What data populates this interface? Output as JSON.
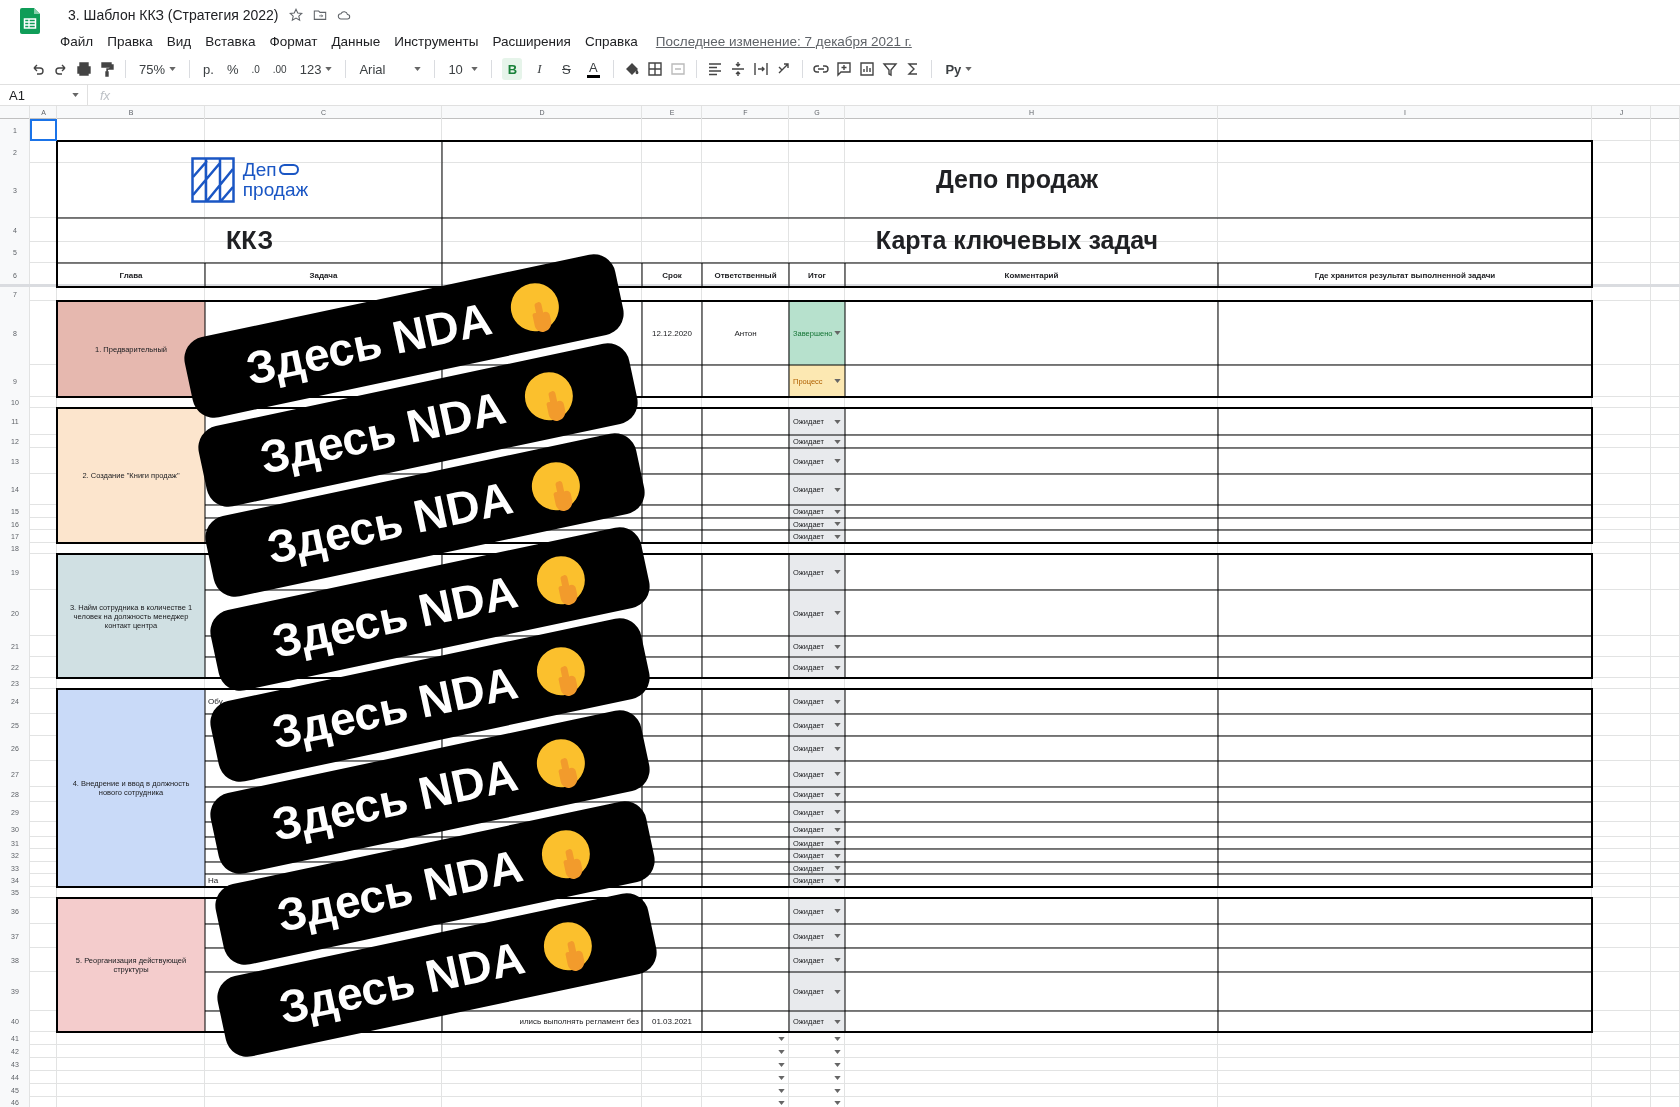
{
  "document": {
    "title": "3. Шаблон ККЗ (Стратегия 2022)"
  },
  "menu": [
    "Файл",
    "Правка",
    "Вид",
    "Вставка",
    "Формат",
    "Данные",
    "Инструменты",
    "Расширения",
    "Справка"
  ],
  "last_edit": "Последнее изменение: 7 декабря 2021 г.",
  "toolbar": {
    "zoom": "75%",
    "currency": "р.",
    "percent": "%",
    "decrease_decimals": ".0",
    "increase_decimals": ".00",
    "number_format": "123",
    "font": "Arial",
    "font_size": "10",
    "input_tools": "Ру",
    "styles": [
      {
        "label": "B",
        "selected": true
      },
      {
        "label": "I",
        "selected": false
      },
      {
        "label": "S",
        "selected": false
      },
      {
        "label": "A",
        "selected": false
      }
    ]
  },
  "formula_bar": {
    "cell": "A1",
    "fx": "fx"
  },
  "columns": [
    "A",
    "B",
    "C",
    "D",
    "E",
    "F",
    "G",
    "H",
    "I",
    "J"
  ],
  "row_numbers": [
    "1",
    "2",
    "3",
    "4",
    "5",
    "6",
    "7",
    "8",
    "9",
    "10",
    "11",
    "12",
    "13",
    "14",
    "15",
    "16",
    "17",
    "18",
    "19",
    "20",
    "21",
    "22",
    "23",
    "24",
    "25",
    "26",
    "27",
    "28",
    "29",
    "30",
    "31",
    "32",
    "33",
    "34",
    "35",
    "36",
    "37",
    "38",
    "39",
    "40",
    "41",
    "42",
    "43",
    "44",
    "45",
    "46"
  ],
  "sheet": {
    "logo": {
      "line1": "Деп",
      "line2": "продаж"
    },
    "title": "Депо продаж",
    "code": "ККЗ",
    "subtitle": "Карта ключевых задач",
    "headers": [
      "Глава",
      "Задача",
      "Срок",
      "Ответственный",
      "Итог",
      "Комментарий",
      "Где хранится результат выполненной задачи"
    ],
    "sections": [
      {
        "chapter": "1. Предварительный",
        "color": "#e6b8af",
        "tasks": [
          {
            "deadline": "12.12.2020",
            "owner": "Антон",
            "status": {
              "label": "Завершено",
              "kind": "done"
            }
          },
          {
            "status": {
              "label": "Процесс",
              "kind": "process"
            }
          }
        ]
      },
      {
        "chapter": "2. Создание \"Книги продаж\"",
        "color": "#fce5cd",
        "tasks": [
          {
            "status": {
              "label": "Ожидает",
              "kind": "waiting"
            }
          },
          {
            "status": {
              "label": "Ожидает",
              "kind": "waiting"
            }
          },
          {
            "status": {
              "label": "Ожидает",
              "kind": "waiting"
            }
          },
          {
            "status": {
              "label": "Ожидает",
              "kind": "waiting"
            }
          },
          {
            "status": {
              "label": "Ожидает",
              "kind": "waiting"
            }
          },
          {
            "status": {
              "label": "Ожидает",
              "kind": "waiting"
            }
          },
          {
            "status": {
              "label": "Ожидает",
              "kind": "waiting"
            }
          }
        ]
      },
      {
        "chapter": "3. Найм сотрудника в количестве 1 человек на должность менеджер контакт центра",
        "color": "#d0e0e3",
        "tasks": [
          {
            "status": {
              "label": "Ожидает",
              "kind": "waiting"
            }
          },
          {
            "status": {
              "label": "Ожидает",
              "kind": "waiting"
            }
          },
          {
            "status": {
              "label": "Ожидает",
              "kind": "waiting"
            }
          },
          {
            "status": {
              "label": "Ожидает",
              "kind": "waiting"
            }
          }
        ]
      },
      {
        "chapter": "4. Внедрение и ввод в должность нового сотрудника",
        "color": "#c9daf8",
        "tasks": [
          {
            "task": "Обу",
            "status": {
              "label": "Ожидает",
              "kind": "waiting"
            }
          },
          {
            "status": {
              "label": "Ожидает",
              "kind": "waiting"
            }
          },
          {
            "status": {
              "label": "Ожидает",
              "kind": "waiting"
            }
          },
          {
            "status": {
              "label": "Ожидает",
              "kind": "waiting"
            }
          },
          {
            "status": {
              "label": "Ожидает",
              "kind": "waiting"
            }
          },
          {
            "status": {
              "label": "Ожидает",
              "kind": "waiting"
            }
          },
          {
            "status": {
              "label": "Ожидает",
              "kind": "waiting"
            }
          },
          {
            "status": {
              "label": "Ожидает",
              "kind": "waiting"
            }
          },
          {
            "status": {
              "label": "Ожидает",
              "kind": "waiting"
            }
          },
          {
            "status": {
              "label": "Ожидает",
              "kind": "waiting"
            }
          },
          {
            "task": "На",
            "status": {
              "label": "Ожидает",
              "kind": "waiting"
            }
          }
        ]
      },
      {
        "chapter": "5. Реорганизация действующей структуры",
        "color": "#f4cccc",
        "tasks": [
          {
            "status": {
              "label": "Ожидает",
              "kind": "waiting"
            }
          },
          {
            "status": {
              "label": "Ожидает",
              "kind": "waiting"
            }
          },
          {
            "status": {
              "label": "Ожидает",
              "kind": "waiting"
            }
          },
          {
            "status": {
              "label": "Ожидает",
              "kind": "waiting"
            }
          },
          {
            "plan": "ились выполнять регламент без",
            "deadline": "01.03.2021",
            "status": {
              "label": "Ожидает",
              "kind": "waiting"
            }
          }
        ]
      }
    ],
    "blank_rows": [
      {
        "owner_dropdown": true,
        "status_dropdown": true
      },
      {
        "owner_dropdown": true,
        "status_dropdown": true
      },
      {
        "owner_dropdown": true,
        "status_dropdown": true
      },
      {
        "owner_dropdown": true,
        "status_dropdown": true
      },
      {
        "owner_dropdown": true,
        "status_dropdown": true
      },
      {
        "owner_dropdown": true,
        "status_dropdown": true
      }
    ]
  },
  "stickers": [
    {
      "text": "Здесь NDA"
    },
    {
      "text": "Здесь NDA"
    },
    {
      "text": "Здесь NDA"
    },
    {
      "text": "Здесь NDA"
    },
    {
      "text": "Здесь NDA"
    },
    {
      "text": "Здесь NDA"
    },
    {
      "text": "Здесь NDA"
    },
    {
      "text": "Здесь NDA"
    }
  ]
}
